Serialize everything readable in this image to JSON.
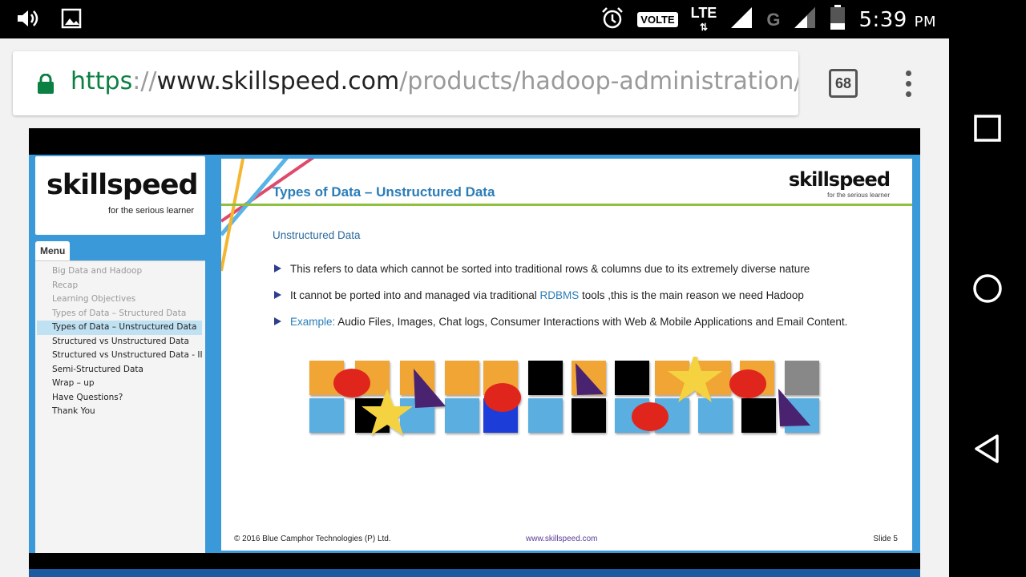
{
  "status_bar": {
    "time": "5:39",
    "ampm": "PM",
    "volte": "VOLTE",
    "lte": "LTE",
    "g": "G"
  },
  "browser": {
    "url_scheme": "https",
    "url_sep": "://",
    "url_host": "www.skillspeed.com",
    "url_path": "/products/hadoop-administration/c",
    "tab_count": "68"
  },
  "sidebar": {
    "logo": {
      "text": "skillspeed",
      "tagline": "for the serious learner"
    },
    "menu_tab": "Menu",
    "items": [
      {
        "label": "Big Data and Hadoop",
        "state": "visited"
      },
      {
        "label": "Recap",
        "state": "visited"
      },
      {
        "label": "Learning Objectives",
        "state": "visited"
      },
      {
        "label": "Types of Data – Structured Data",
        "state": "visited"
      },
      {
        "label": "Types of Data – Unstructured Data",
        "state": "active"
      },
      {
        "label": "Structured vs Unstructured Data",
        "state": "unvisited"
      },
      {
        "label": "Structured vs Unstructured Data - II",
        "state": "unvisited"
      },
      {
        "label": "Semi-Structured Data",
        "state": "unvisited"
      },
      {
        "label": "Wrap – up",
        "state": "unvisited"
      },
      {
        "label": "Have Questions?",
        "state": "unvisited"
      },
      {
        "label": "Thank You",
        "state": "unvisited"
      }
    ]
  },
  "slide": {
    "title": "Types of Data – Unstructured Data",
    "logo": {
      "text": "skillspeed",
      "tagline": "for the serious learner"
    },
    "subtitle": "Unstructured Data",
    "bullets": {
      "b1": "This refers to data which cannot be sorted into traditional rows & columns due to its extremely diverse nature",
      "b2_pre": "It cannot be ported into and managed via traditional ",
      "b2_link": "RDBMS",
      "b2_post": " tools ,this is the main reason we need Hadoop",
      "b3_label": "Example:",
      "b3_text": " Audio Files, Images, Chat logs, Consumer Interactions with Web & Mobile Applications and Email Content."
    },
    "footer": {
      "copyright": "© 2016 Blue Camphor Technologies (P) Ltd.",
      "website": "www.skillspeed.com",
      "slide_no": "Slide 5"
    }
  },
  "colors": {
    "accent_blue": "#2a7db8",
    "green_rule": "#8fc03f",
    "player_bg": "#3a9ad9",
    "tile_orange": "#f0a535",
    "tile_blue": "#5aaee0",
    "tile_black": "#000000",
    "shape_red": "#e0261b",
    "shape_purple": "#4a2470",
    "star_yellow": "#f5d340"
  }
}
